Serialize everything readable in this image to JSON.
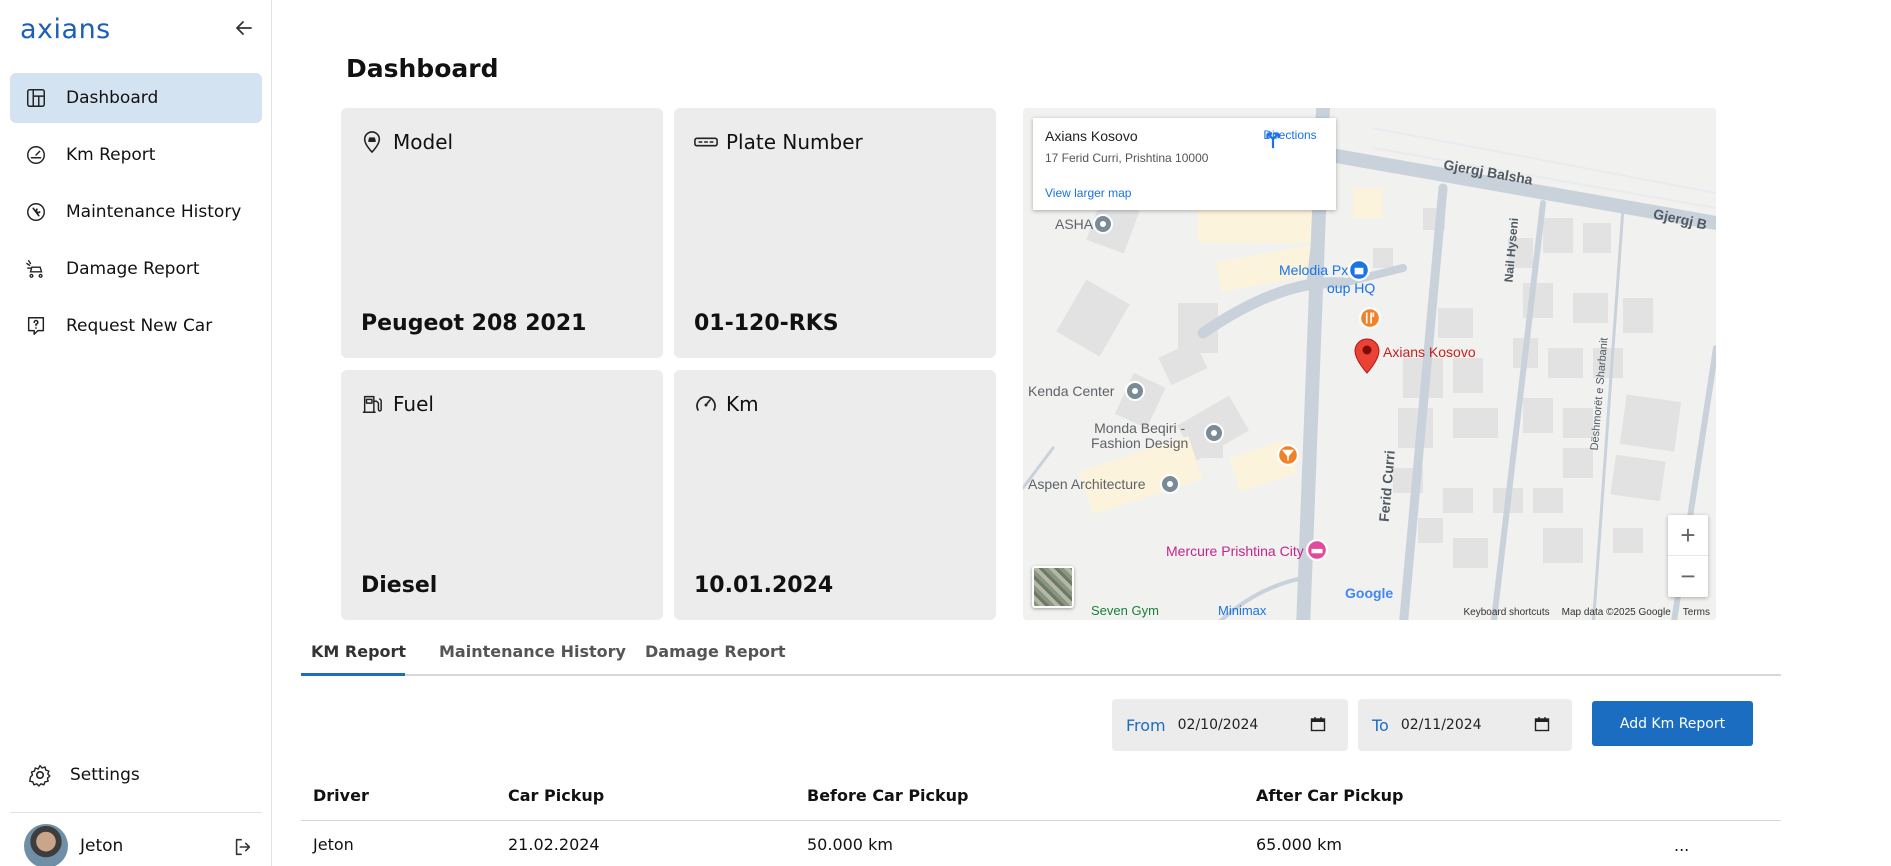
{
  "brand": {
    "logo_text": "axians",
    "color": "#1b5fb7"
  },
  "sidebar": {
    "items": [
      {
        "label": "Dashboard",
        "icon": "dashboard-icon",
        "active": true
      },
      {
        "label": "Km Report",
        "icon": "speedometer-icon",
        "active": false
      },
      {
        "label": "Maintenance History",
        "icon": "wrench-circle-icon",
        "active": false
      },
      {
        "label": "Damage Report",
        "icon": "car-crash-icon",
        "active": false
      },
      {
        "label": "Request New Car",
        "icon": "question-message-icon",
        "active": false
      }
    ],
    "settings_label": "Settings",
    "user_name": "Jeton"
  },
  "page_title": "Dashboard",
  "cards": {
    "model": {
      "label": "Model",
      "value": "Peugeot 208 2021"
    },
    "plate": {
      "label": "Plate Number",
      "value": "01-120-RKS"
    },
    "fuel": {
      "label": "Fuel",
      "value": "Diesel"
    },
    "km": {
      "label": "Km",
      "value": "10.01.2024"
    }
  },
  "map": {
    "place": "Axians Kosovo",
    "address": "17 Ferid Curri, Prishtina 10000",
    "directions": "Directions",
    "larger_map": "View larger map",
    "pin_label": "Axians Kosovo",
    "labels": {
      "asha": "ASHA",
      "melodia": "Melodia Px",
      "kenda": "Kenda Center",
      "monda": "Monda Beqiri -\nFashion Design",
      "aspen": "Aspen Architecture",
      "mercure": "Mercure Prishtina City",
      "group_hq": "oup HQ",
      "gjergj_balsha": "Gjergj Balsha",
      "gjergj_b": "Gjergj B",
      "ferid_curri": "Ferid Curri",
      "nail_hyseni": "Nail Hyseni",
      "sharbanit": "Dëshmorët e Sharbanit",
      "seven": "Seven Gym",
      "minimax": "Minimax"
    },
    "google": "Google",
    "footer": {
      "shortcuts": "Keyboard shortcuts",
      "data": "Map data ©2025 Google",
      "terms": "Terms"
    },
    "zoom_in": "+",
    "zoom_out": "−"
  },
  "tabs": [
    {
      "label": "KM Report",
      "active": true
    },
    {
      "label": "Maintenance History",
      "active": false
    },
    {
      "label": "Damage Report",
      "active": false
    }
  ],
  "filters": {
    "from_label": "From",
    "from_value": "02/10/2024",
    "to_label": "To",
    "to_value": "02/11/2024",
    "add_button": "Add Km Report"
  },
  "table": {
    "columns": [
      "Driver",
      "Car Pickup",
      "Before Car Pickup",
      "After Car Pickup"
    ],
    "rows": [
      {
        "driver": "Jeton",
        "car_pickup": "21.02.2024",
        "before": "50.000 km",
        "after": "65.000 km",
        "more": "..."
      }
    ]
  },
  "colors": {
    "accent": "#1b6dc1",
    "active_nav": "#d3e3f2",
    "card_bg": "#ececec"
  }
}
